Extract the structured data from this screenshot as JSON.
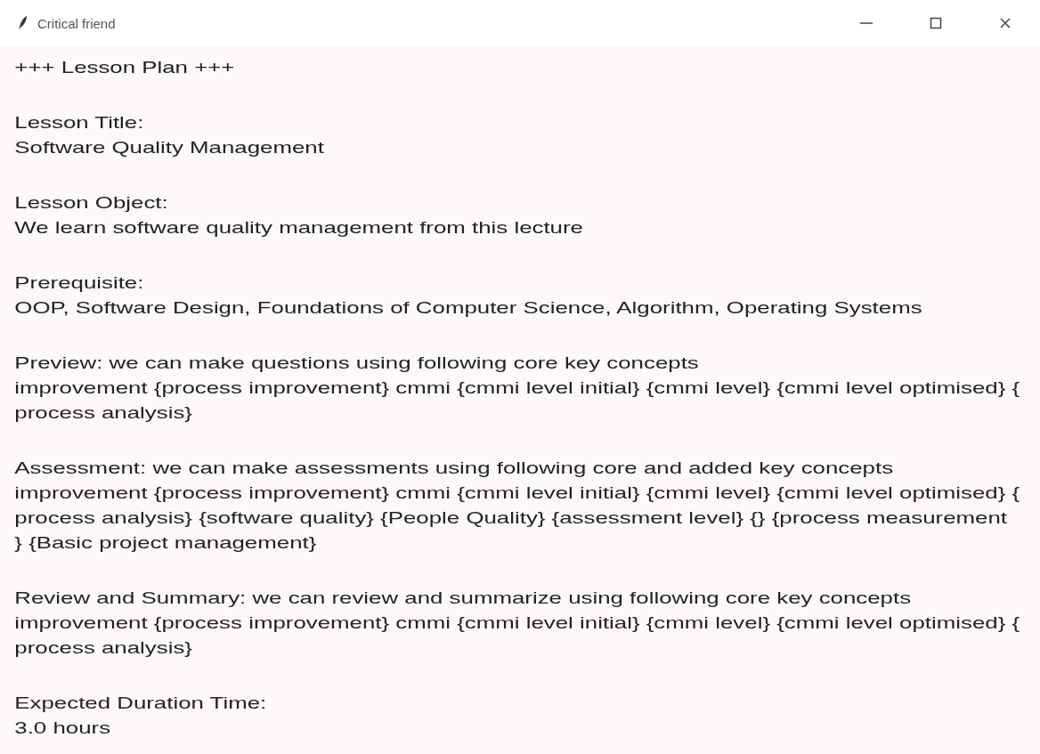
{
  "window": {
    "title": "Critical friend"
  },
  "blocks": [
    {
      "lines": [
        "+++ Lesson Plan +++"
      ]
    },
    {
      "lines": [
        "Lesson Title:",
        "Software Quality Management"
      ]
    },
    {
      "lines": [
        "Lesson Object:",
        "We learn software quality management from this lecture"
      ]
    },
    {
      "lines": [
        "Prerequisite:",
        "OOP, Software Design, Foundations of Computer Science, Algorithm, Operating Systems"
      ]
    },
    {
      "lines": [
        "Preview: we can make questions using following core key concepts",
        "improvement {process improvement} cmmi {cmmi level initial} {cmmi level} {cmmi level optimised} {",
        "process analysis}"
      ]
    },
    {
      "lines": [
        "Assessment: we can make assessments using following core and added key concepts",
        "improvement {process improvement} cmmi {cmmi level initial} {cmmi level} {cmmi level optimised} {",
        "process analysis} {software quality} {People Quality} {assessment level} {} {process measurement",
        "} {Basic project management}"
      ]
    },
    {
      "lines": [
        "Review and Summary: we can review and summarize using following core key concepts",
        "improvement {process improvement} cmmi {cmmi level initial} {cmmi level} {cmmi level optimised} {",
        "process analysis}"
      ]
    },
    {
      "lines": [
        "Expected Duration Time:",
        "3.0 hours"
      ]
    }
  ]
}
